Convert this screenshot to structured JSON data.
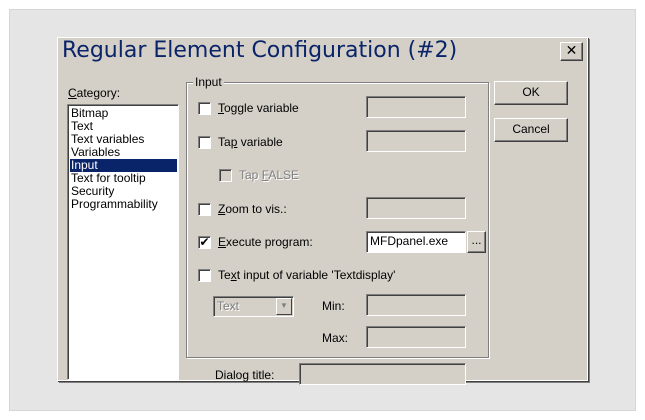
{
  "window": {
    "title": "Regular Element Configuration (#2)",
    "close_glyph": "✕"
  },
  "category": {
    "label_first": "C",
    "label_rest": "ategory:",
    "items": [
      "Bitmap",
      "Text",
      "Text variables",
      "Variables",
      "Input",
      "Text for tooltip",
      "Security",
      "Programmability"
    ],
    "selected": "Input"
  },
  "input_group": {
    "caption": "Input",
    "toggle": {
      "pre": "",
      "ul": "T",
      "post": "oggle variable",
      "checked": false,
      "value": ""
    },
    "tap": {
      "pre": "Ta",
      "ul": "p",
      "post": " variable",
      "checked": false,
      "value": ""
    },
    "tap_false": {
      "pre": "Tap ",
      "ul": "F",
      "post": "ALSE",
      "checked": false,
      "enabled": false
    },
    "zoom": {
      "pre": "",
      "ul": "Z",
      "post": "oom to vis.:",
      "checked": false,
      "value": ""
    },
    "execute": {
      "pre": "",
      "ul": "E",
      "post": "xecute program:",
      "checked": true,
      "value": "MFDpanel.exe",
      "browse_label": "..."
    },
    "text_input": {
      "pre": "Te",
      "ul": "x",
      "post": "t input of variable 'Textdisplay'",
      "checked": false
    },
    "type_select": {
      "value": "Text",
      "arrow": "▼"
    },
    "min_label": "Min:",
    "max_label": "Max:",
    "min_value": "",
    "max_value": ""
  },
  "dialog_title": {
    "label": "Dialog title:",
    "value": ""
  },
  "buttons": {
    "ok": "OK",
    "cancel": "Cancel"
  },
  "check_glyph": "✔"
}
